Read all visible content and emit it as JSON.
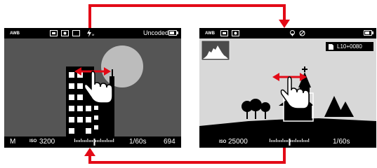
{
  "left": {
    "top": {
      "af_mode": "AWB",
      "coded_status": "Uncoded",
      "battery_level": 0.8
    },
    "bottom": {
      "mode": "M",
      "iso": "3200",
      "shutter": "1/60s",
      "shots_remaining": "694"
    }
  },
  "right": {
    "top": {
      "af_mode": "AWB",
      "battery_level": 0.8
    },
    "file_badge": "L10+0080",
    "bottom": {
      "iso_prefix": "ISO",
      "iso": "25000",
      "shutter": "1/60s"
    }
  },
  "colors": {
    "arrow": "#e30a17",
    "left_scene_bg": "#555555",
    "moon": "#bcbcbc",
    "right_scene_bg": "#d8d8d8"
  }
}
